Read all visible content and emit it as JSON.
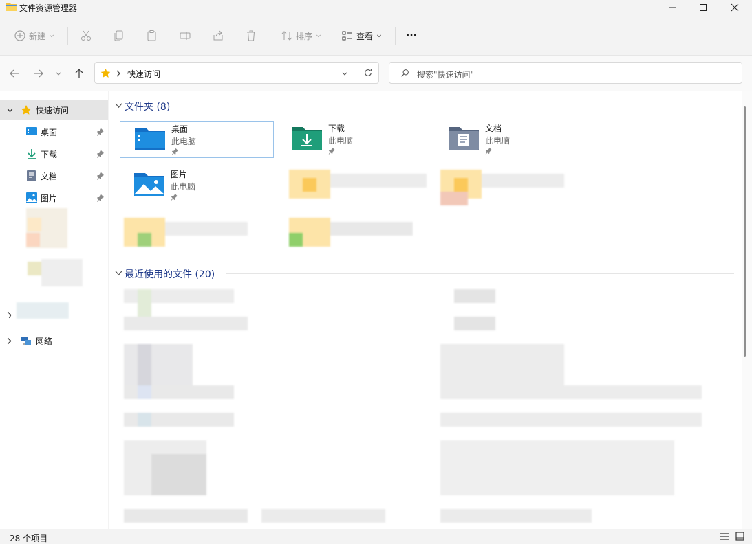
{
  "window": {
    "title": "文件资源管理器"
  },
  "toolbar": {
    "new_label": "新建",
    "sort_label": "排序",
    "view_label": "查看",
    "more_label": "···"
  },
  "address": {
    "path": "快速访问"
  },
  "search": {
    "placeholder": "搜索\"快速访问\""
  },
  "sidebar": {
    "quick_access": "快速访问",
    "items": [
      {
        "label": "桌面",
        "icon": "desktop-icon"
      },
      {
        "label": "下载",
        "icon": "download-icon"
      },
      {
        "label": "文档",
        "icon": "document-icon"
      },
      {
        "label": "图片",
        "icon": "picture-icon"
      }
    ],
    "network": "网络"
  },
  "folders": {
    "heading": "文件夹 (8)",
    "items": [
      {
        "name": "桌面",
        "sub": "此电脑",
        "icon": "desktop-folder-icon"
      },
      {
        "name": "下载",
        "sub": "此电脑",
        "icon": "download-folder-icon"
      },
      {
        "name": "文档",
        "sub": "此电脑",
        "icon": "document-folder-icon"
      },
      {
        "name": "图片",
        "sub": "此电脑",
        "icon": "picture-folder-icon"
      }
    ]
  },
  "recent": {
    "heading": "最近使用的文件 (20)"
  },
  "status": {
    "count": "28 个项目"
  },
  "colors": {
    "accent": "#1f3a8a",
    "folder_blue": "#1e8ee0",
    "folder_green": "#1f9e7a"
  }
}
